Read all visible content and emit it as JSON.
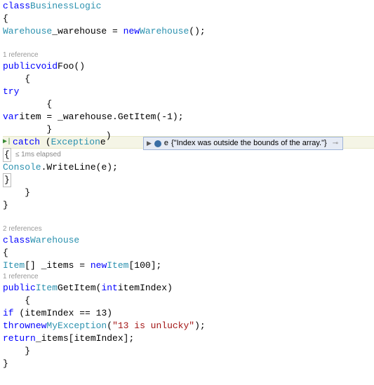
{
  "class1": {
    "keyword_class": "class",
    "name": "BusinessLogic",
    "field_type": "Warehouse",
    "field_name": "_warehouse",
    "field_new": "new",
    "field_ctor": "Warehouse",
    "codelens_foo": "1 reference",
    "foo_public": "public",
    "foo_void": "void",
    "foo_name": "Foo",
    "try_kw": "try",
    "var_kw": "var",
    "item_name": "item",
    "invoke_target": "_warehouse",
    "invoke_method": "GetItem",
    "invoke_arg": "-1",
    "catch_kw": "catch",
    "exception_type": "Exception",
    "exception_var": "e",
    "perf_tip": "≤ 1ms elapsed",
    "console_type": "Console",
    "writeline": "WriteLine",
    "writeline_arg": "e"
  },
  "datatip": {
    "var": "e",
    "value": "{\"Index was outside the bounds of the array.\"}"
  },
  "class2": {
    "codelens": "2 references",
    "keyword_class": "class",
    "name": "Warehouse",
    "arr_type": "Item",
    "arr_name": "_items",
    "arr_new": "new",
    "arr_ctor": "Item",
    "arr_size": "100",
    "codelens_getitem": "1 reference",
    "gi_public": "public",
    "gi_ret": "Item",
    "gi_name": "GetItem",
    "gi_param_type": "int",
    "gi_param_name": "itemIndex",
    "if_kw": "if",
    "if_var": "itemIndex",
    "if_val": "13",
    "throw_kw": "throw",
    "throw_new": "new",
    "throw_type": "MyException",
    "throw_msg": "\"13 is unlucky\"",
    "return_kw": "return",
    "return_arr": "_items",
    "return_idx": "itemIndex"
  }
}
